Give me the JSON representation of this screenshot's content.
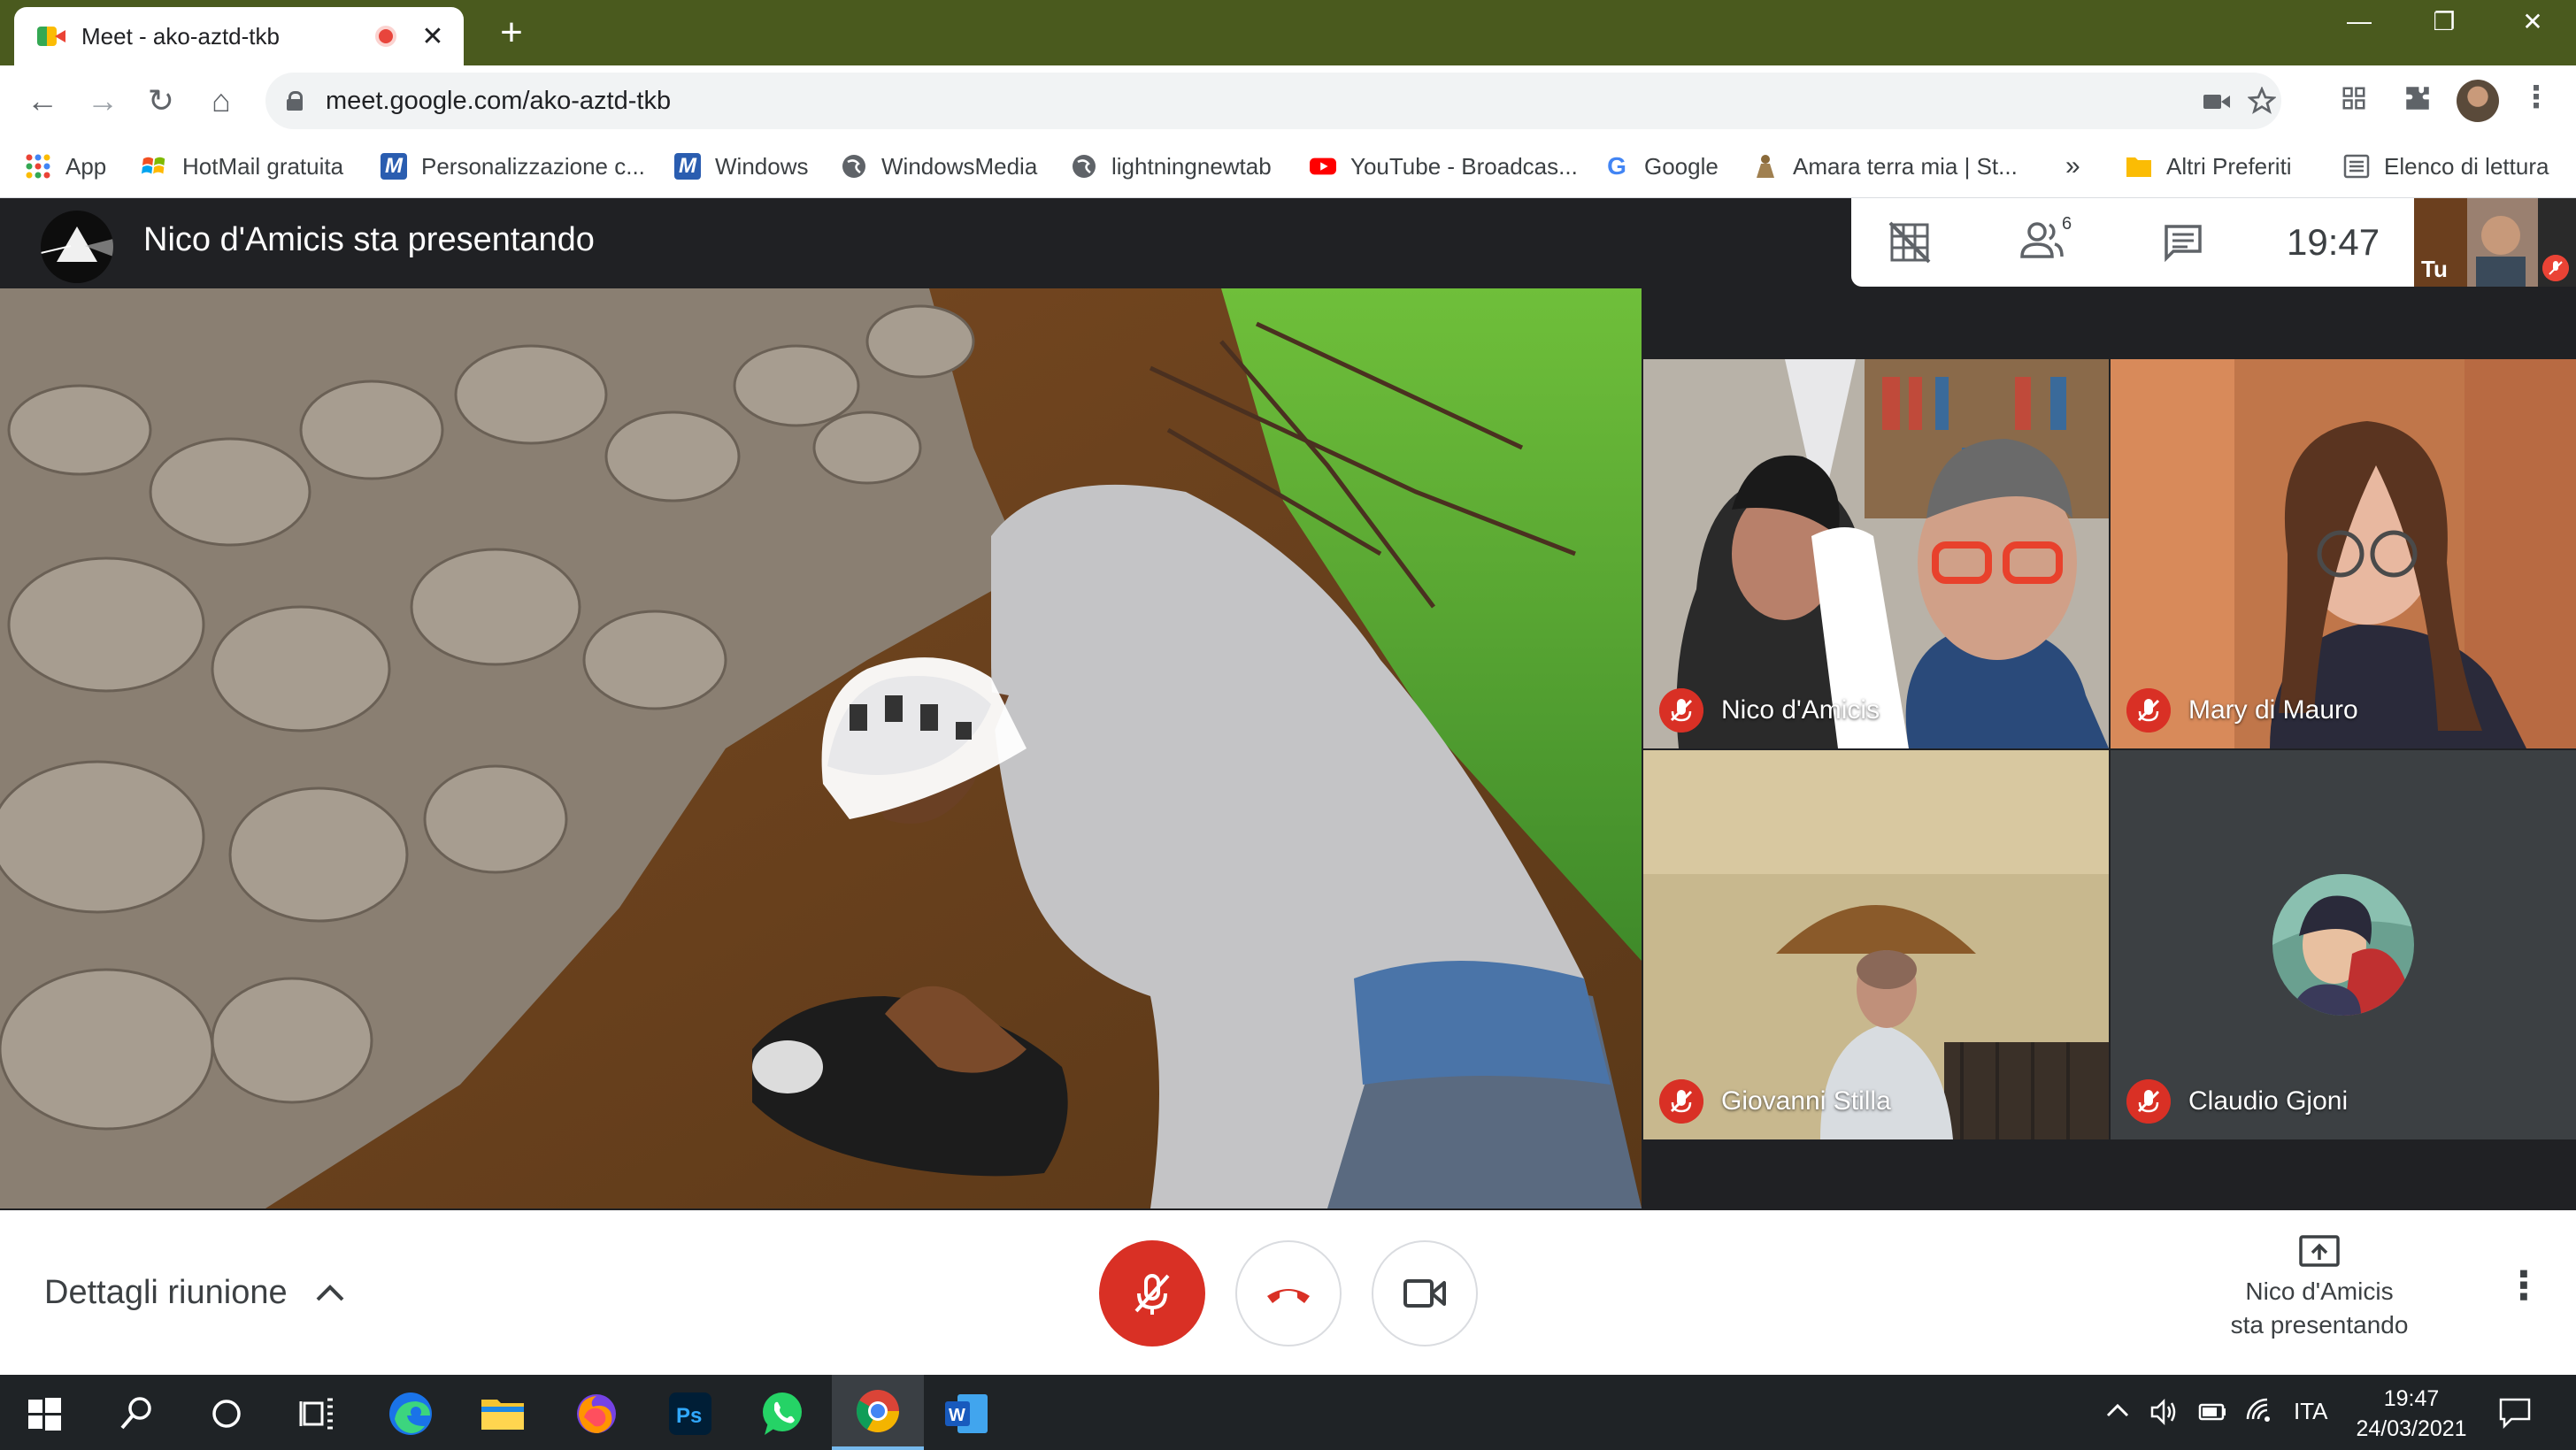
{
  "browser": {
    "tab": {
      "title": "Meet - ako-aztd-tkb",
      "close": "✕"
    },
    "new_tab": "+",
    "window_controls": {
      "minimize": "—",
      "restore": "❐",
      "close": "✕"
    },
    "nav": {
      "back": "←",
      "forward": "→",
      "reload": "↻",
      "home": "⌂"
    },
    "url": "meet.google.com/ako-aztd-tkb",
    "bookmarks": [
      {
        "label": "App",
        "icon": "apps-grid-icon"
      },
      {
        "label": "HotMail gratuita",
        "icon": "windows-flag-icon"
      },
      {
        "label": "Personalizzazione c...",
        "icon": "m-logo-icon"
      },
      {
        "label": "Windows",
        "icon": "m-logo-icon"
      },
      {
        "label": "WindowsMedia",
        "icon": "globe-icon"
      },
      {
        "label": "lightningnewtab",
        "icon": "globe-icon"
      },
      {
        "label": "YouTube - Broadcas...",
        "icon": "youtube-icon"
      },
      {
        "label": "Google",
        "icon": "google-icon"
      },
      {
        "label": "Amara terra mia | St...",
        "icon": "figure-icon"
      }
    ],
    "bookmarks_overflow": "»",
    "other_bookmarks": "Altri Preferiti",
    "reading_list": "Elenco di lettura"
  },
  "meet": {
    "presenter_title": "Nico d'Amicis sta presentando",
    "participant_count": "6",
    "time": "19:47",
    "self_label": "Tu",
    "participants": [
      {
        "name": "Nico d'Amicis"
      },
      {
        "name": "Mary di Mauro"
      },
      {
        "name": "Giovanni Stilla"
      },
      {
        "name": "Claudio Gjoni"
      }
    ],
    "controls": {
      "details": "Dettagli riunione",
      "present_line1": "Nico d'Amicis",
      "present_line2": "sta presentando",
      "more": "⋮"
    },
    "colors": {
      "mic_muted": "#ea4335",
      "accent": "#1a73e8"
    }
  },
  "taskbar": {
    "language": "ITA",
    "time": "19:47",
    "date": "24/03/2021"
  }
}
